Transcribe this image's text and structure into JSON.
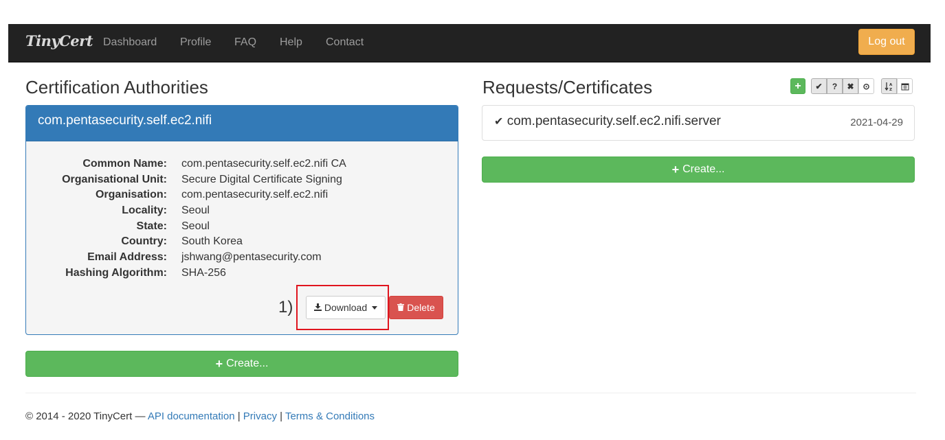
{
  "navbar": {
    "brand": "TinyCert",
    "links": [
      "Dashboard",
      "Profile",
      "FAQ",
      "Help",
      "Contact"
    ],
    "logout": "Log out"
  },
  "ca": {
    "heading": "Certification Authorities",
    "panel_title": "com.pentasecurity.self.ec2.nifi",
    "fields": [
      {
        "label": "Common Name:",
        "value": "com.pentasecurity.self.ec2.nifi CA"
      },
      {
        "label": "Organisational Unit:",
        "value": "Secure Digital Certificate Signing"
      },
      {
        "label": "Organisation:",
        "value": "com.pentasecurity.self.ec2.nifi"
      },
      {
        "label": "Locality:",
        "value": "Seoul"
      },
      {
        "label": "State:",
        "value": "Seoul"
      },
      {
        "label": "Country:",
        "value": "South Korea"
      },
      {
        "label": "Email Address:",
        "value": "jshwang@pentasecurity.com"
      },
      {
        "label": "Hashing Algorithm:",
        "value": "SHA-256"
      }
    ],
    "annotation": "1)",
    "download_label": "Download",
    "delete_label": "Delete",
    "create_label": "Create..."
  },
  "requests": {
    "heading": "Requests/Certificates",
    "items": [
      {
        "name": "com.pentasecurity.self.ec2.nifi.server",
        "date": "2021-04-29"
      }
    ],
    "create_label": "Create...",
    "toolbar": {
      "add": "+",
      "filters": [
        "✔",
        "?",
        "✖",
        "⊙"
      ],
      "sort": [
        "↓A-Z",
        "calendar"
      ]
    }
  },
  "footer": {
    "copyright": "© 2014 - 2020 TinyCert — ",
    "api_doc": "API documentation",
    "sep1": " | ",
    "privacy": "Privacy",
    "sep2": " | ",
    "terms": "Terms & Conditions"
  },
  "colors": {
    "primary": "#337ab7",
    "success": "#5cb85c",
    "danger": "#d9534f",
    "warning": "#f0ad4e",
    "annotation_box": "#e0141e"
  }
}
